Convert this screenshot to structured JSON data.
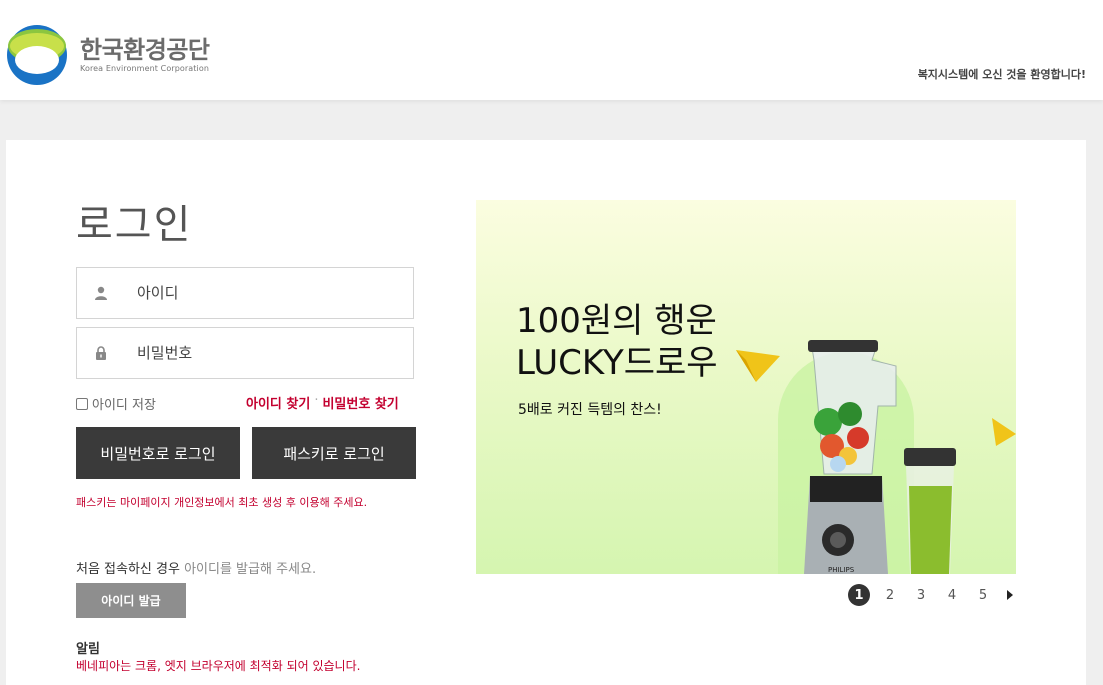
{
  "header": {
    "logo_ko": "한국환경공단",
    "logo_en": "Korea Environment Corporation",
    "welcome": "복지시스템에 오신 것을 환영합니다!"
  },
  "login": {
    "title": "로그인",
    "id_placeholder": "아이디",
    "pw_placeholder": "비밀번호",
    "save_id_label": "아이디 저장",
    "find_id": "아이디 찾기",
    "find_sep": "·",
    "find_pw": "비밀번호 찾기",
    "btn_password_login": "비밀번호로 로그인",
    "btn_passkey_login": "패스키로 로그인",
    "passkey_note": "패스키는 마이페이지 개인정보에서 최초 생성 후 이용해 주세요.",
    "first_visit_prefix": "처음 접속하신 경우 ",
    "first_visit_suffix": "아이디를 발급해 주세요.",
    "btn_issue_id": "아이디 발급",
    "notice_title": "알림",
    "notice_text": "베네피아는 크롬, 엣지 브라우저에 최적화 되어 있습니다."
  },
  "banner": {
    "title_line1": "100원의 행운",
    "title_line2": "LUCKY드로우",
    "subtitle": "5배로 커진 득템의 찬스!",
    "brand_text": "PHILIPS"
  },
  "pager": {
    "pages": [
      "1",
      "2",
      "3",
      "4",
      "5"
    ],
    "active": "1"
  },
  "colors": {
    "accent_red": "#c3002f",
    "dark_button": "#3a3a3a",
    "issue_button": "#8e8e8e",
    "logo_blue": "#1a73c5",
    "logo_green": "#8cc63f"
  }
}
